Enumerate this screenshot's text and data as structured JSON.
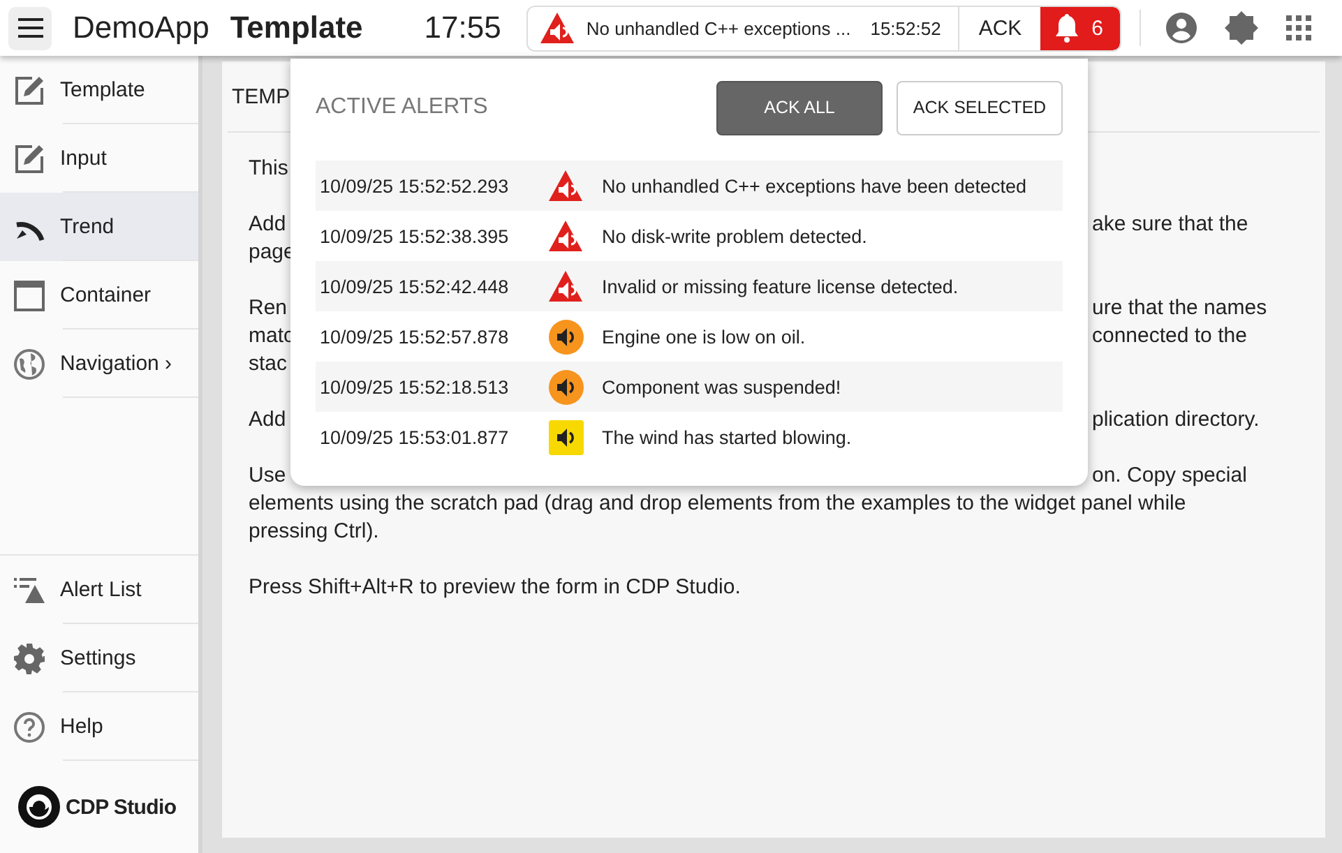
{
  "topbar": {
    "app_name": "DemoApp",
    "page_title": "Template",
    "clock": "17:55",
    "banner": {
      "kind": "error",
      "message": "No unhandled C++ exceptions ...",
      "time": "15:52:52",
      "ack": "ACK"
    },
    "alert_count": "6"
  },
  "sidebar": {
    "items": [
      {
        "label": "Template",
        "selected": false
      },
      {
        "label": "Input",
        "selected": false
      },
      {
        "label": "Trend",
        "selected": true
      },
      {
        "label": "Container",
        "selected": false
      },
      {
        "label": "Navigation ›",
        "selected": false
      }
    ],
    "bottom_items": [
      {
        "label": "Alert List",
        "selected": false
      },
      {
        "label": "Settings",
        "selected": false
      },
      {
        "label": "Help",
        "selected": false
      }
    ],
    "logo": "CDP Studio"
  },
  "card": {
    "title": "TEMP",
    "paragraphs": [
      {
        "lines": [
          {
            "left": "This"
          }
        ]
      },
      {
        "lines": [
          {
            "left": "Add",
            "right": "ake sure that the"
          },
          {
            "left": "page"
          }
        ]
      },
      {
        "lines": [
          {
            "left": "Ren",
            "right": "ure that the names"
          },
          {
            "left": "matc",
            "right": "connected to the"
          },
          {
            "left": "stac"
          }
        ]
      },
      {
        "lines": [
          {
            "left": "Add",
            "right": "plication directory."
          }
        ]
      },
      {
        "lines": [
          {
            "left": "Use",
            "right": "on. Copy special"
          },
          {
            "left": "elements using the scratch pad (drag and drop elements from the examples to the widget panel while"
          },
          {
            "left": "pressing Ctrl)."
          }
        ]
      },
      {
        "lines": [
          {
            "left": "Press Shift+Alt+R to preview the form in CDP Studio."
          }
        ]
      }
    ]
  },
  "alerts_popup": {
    "title": "ACTIVE ALERTS",
    "buttons": [
      {
        "label": "ACK ALL",
        "kind": "primary"
      },
      {
        "label": "ACK SELECTED",
        "kind": "secondary"
      }
    ],
    "alerts": [
      {
        "time": "10/09/25 15:52:52.293",
        "kind": "error",
        "message": "No unhandled C++ exceptions have been detected"
      },
      {
        "time": "10/09/25 15:52:38.395",
        "kind": "error",
        "message": "No disk-write problem detected."
      },
      {
        "time": "10/09/25 15:52:42.448",
        "kind": "error",
        "message": "Invalid or missing feature license detected."
      },
      {
        "time": "10/09/25 15:52:57.878",
        "kind": "warning",
        "message": "Engine one is low on oil."
      },
      {
        "time": "10/09/25 15:52:18.513",
        "kind": "warning",
        "message": "Component was suspended!"
      },
      {
        "time": "10/09/25 15:53:01.877",
        "kind": "notice",
        "message": "The wind has started blowing."
      }
    ]
  }
}
